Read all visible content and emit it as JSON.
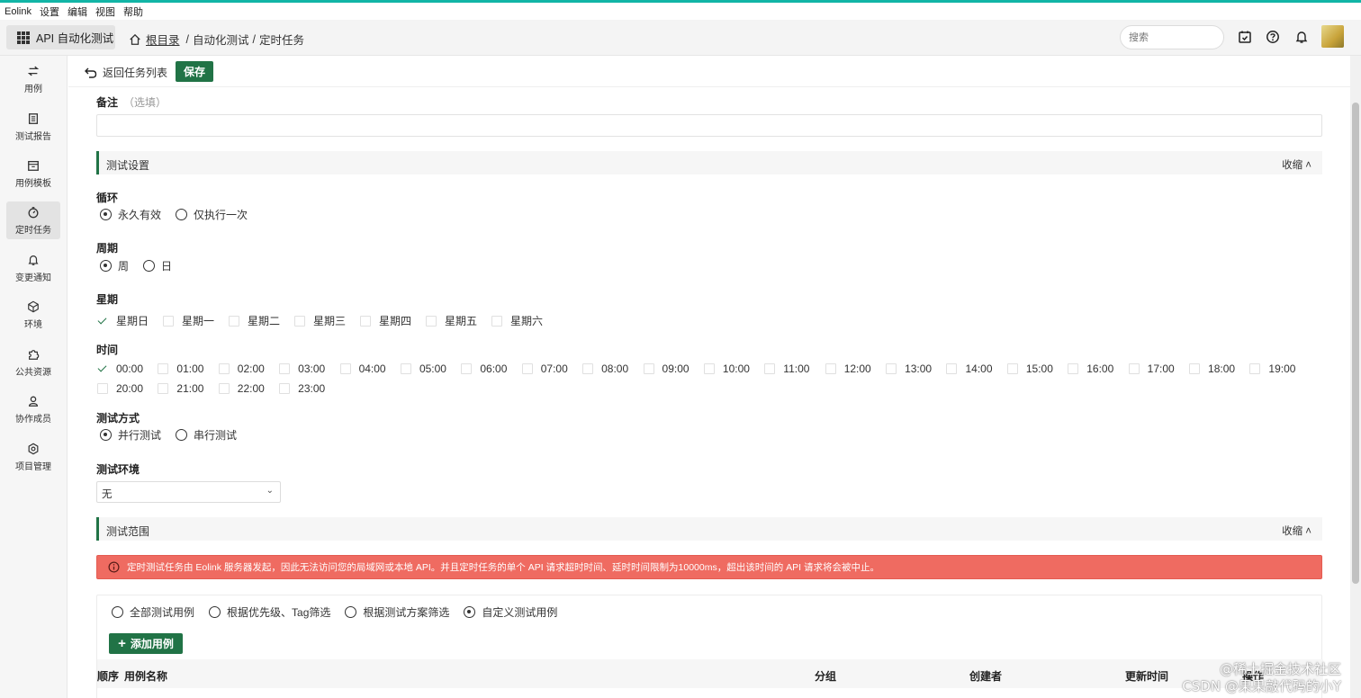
{
  "menubar": {
    "items": [
      "Eolink",
      "设置",
      "编辑",
      "视图",
      "帮助"
    ]
  },
  "header": {
    "project_button": "API 自动化测试",
    "breadcrumb": {
      "root": "根目录",
      "sep1": "/",
      "level1": "自动化测试",
      "sep2": "/",
      "current": "定时任务"
    },
    "search_placeholder": "搜索"
  },
  "sidebar": {
    "items": [
      {
        "label": "用例",
        "icon": "swap-icon"
      },
      {
        "label": "测试报告",
        "icon": "report-icon"
      },
      {
        "label": "用例模板",
        "icon": "template-icon"
      },
      {
        "label": "定时任务",
        "icon": "timer-icon",
        "active": true
      },
      {
        "label": "变更通知",
        "icon": "bell-icon"
      },
      {
        "label": "环境",
        "icon": "environment-icon"
      },
      {
        "label": "公共资源",
        "icon": "puzzle-icon"
      },
      {
        "label": "协作成员",
        "icon": "members-icon"
      },
      {
        "label": "项目管理",
        "icon": "settings-icon"
      }
    ]
  },
  "toolbar": {
    "back_label": "返回任务列表",
    "save_label": "保存"
  },
  "form": {
    "remark_label": "备注",
    "remark_optional": "（选填）",
    "remark_value": "",
    "settings_section": {
      "title": "测试设置",
      "collapse": "收缩 ˄"
    },
    "loop": {
      "label": "循环",
      "options": [
        "永久有效",
        "仅执行一次"
      ],
      "selected": "永久有效"
    },
    "period": {
      "label": "周期",
      "options": [
        "周",
        "日"
      ],
      "selected": "周"
    },
    "weekday": {
      "label": "星期",
      "options": [
        "星期日",
        "星期一",
        "星期二",
        "星期三",
        "星期四",
        "星期五",
        "星期六"
      ],
      "checked": [
        "星期日"
      ]
    },
    "time": {
      "label": "时间",
      "row1": [
        "00:00",
        "01:00",
        "02:00",
        "03:00",
        "04:00",
        "05:00",
        "06:00",
        "07:00",
        "08:00",
        "09:00",
        "10:00",
        "11:00",
        "12:00",
        "13:00",
        "14:00",
        "15:00",
        "16:00",
        "17:00",
        "18:00",
        "19:00"
      ],
      "row2": [
        "20:00",
        "21:00",
        "22:00",
        "23:00"
      ],
      "checked": [
        "00:00"
      ]
    },
    "mode": {
      "label": "测试方式",
      "options": [
        "并行测试",
        "串行测试"
      ],
      "selected": "并行测试"
    },
    "environment": {
      "label": "测试环境",
      "value": "无"
    },
    "scope_section": {
      "title": "测试范围",
      "collapse": "收缩 ˄"
    },
    "alert": "定时测试任务由 Eolink 服务器发起，因此无法访问您的局域网或本地 API。并且定时任务的单个 API 请求超时时间、延时时间限制为10000ms，超出该时间的 API 请求将会被中止。",
    "scope_options": [
      "全部测试用例",
      "根据优先级、Tag筛选",
      "根据测试方案筛选",
      "自定义测试用例"
    ],
    "scope_selected": "自定义测试用例",
    "add_case_label": "添加用例",
    "table_headers": [
      "顺序",
      "用例名称",
      "分组",
      "创建者",
      "更新时间",
      "操作"
    ]
  },
  "watermark": {
    "line1": "@稀土掘金技术社区",
    "line2": "CSDN @果果敲代码的小Y"
  },
  "colors": {
    "accent": "#217346",
    "alert": "#ef6b61",
    "topline": "#12b5a6"
  }
}
